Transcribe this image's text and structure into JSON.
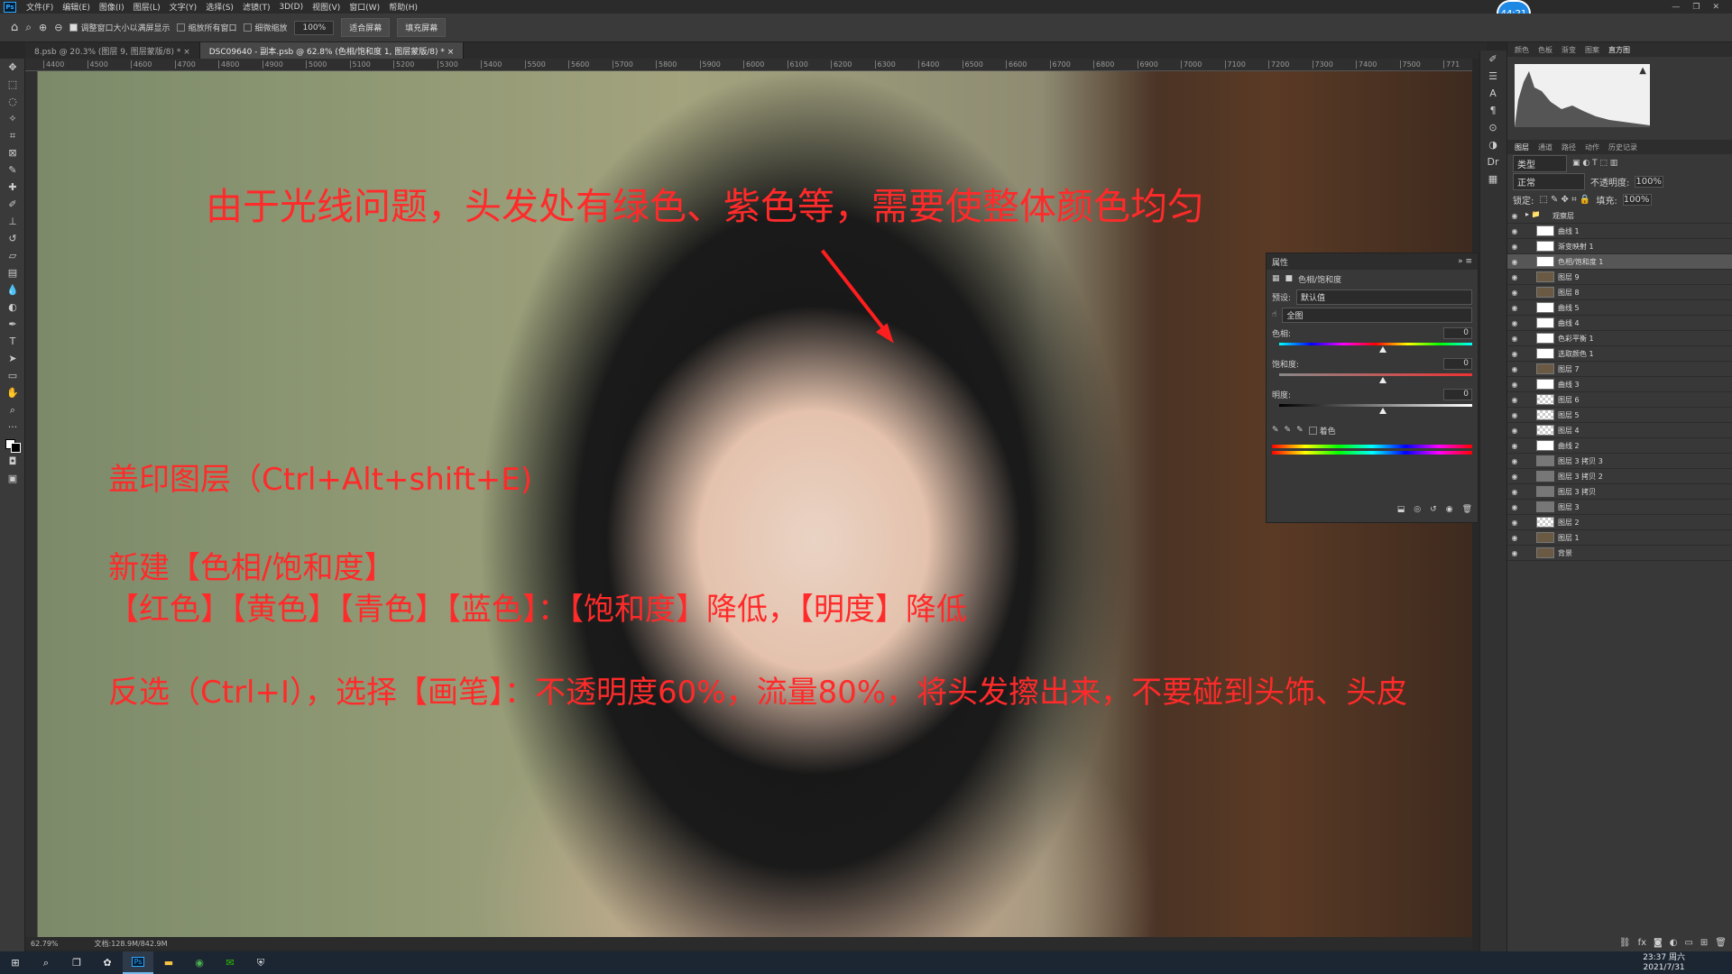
{
  "menubar": {
    "items": [
      "文件(F)",
      "编辑(E)",
      "图像(I)",
      "图层(L)",
      "文字(Y)",
      "选择(S)",
      "滤镜(T)",
      "3D(D)",
      "视图(V)",
      "窗口(W)",
      "帮助(H)"
    ]
  },
  "options": {
    "resize_windows": "调整窗口大小以满屏显示",
    "zoom_all": "缩放所有窗口",
    "scrubby_zoom": "细微缩放",
    "zoom_value": "100%",
    "fit_screen": "适合屏幕",
    "fill_screen": "填充屏幕"
  },
  "doc_tabs": [
    {
      "label": "8.psb @ 20.3% (图层 9, 图层蒙版/8) *"
    },
    {
      "label": "DSC09640 - 副本.psb @ 62.8% (色相/饱和度 1, 图层蒙版/8) *"
    }
  ],
  "ruler_ticks": [
    "4400",
    "4500",
    "4600",
    "4700",
    "4800",
    "4900",
    "5000",
    "5100",
    "5200",
    "5300",
    "5400",
    "5500",
    "5600",
    "5700",
    "5800",
    "5900",
    "6000",
    "6100",
    "6200",
    "6300",
    "6400",
    "6500",
    "6600",
    "6700",
    "6800",
    "6900",
    "7000",
    "7100",
    "7200",
    "7300",
    "7400",
    "7500",
    "771"
  ],
  "annotations": {
    "headline": "由于光线问题，头发处有绿色、紫色等，需要使整体颜色均匀",
    "step1": "盖印图层（Ctrl+Alt+shift+E)",
    "step2": "新建【色相/饱和度】",
    "step3": "【红色】【黄色】【青色】【蓝色】：【饱和度】降低，【明度】降低",
    "step4": "反选（Ctrl+I），选择【画笔】：不透明度60%，流量80%，将头发擦出来，不要碰到头饰、头皮"
  },
  "status": {
    "zoom": "62.79%",
    "doc_size": "文档:128.9M/842.9M"
  },
  "properties": {
    "title": "属性",
    "adj_name": "色相/饱和度",
    "preset_label": "预设:",
    "preset_value": "默认值",
    "range_value": "全图",
    "hue_label": "色相:",
    "hue_value": "0",
    "sat_label": "饱和度:",
    "sat_value": "0",
    "light_label": "明度:",
    "light_value": "0",
    "colorize_label": "着色"
  },
  "timer": "44:21",
  "right_panel": {
    "top_tabs": [
      "颜色",
      "色板",
      "渐变",
      "图案",
      "直方图"
    ],
    "layer_tabs": [
      "图层",
      "通道",
      "路径",
      "动作",
      "历史记录"
    ],
    "kind_filter": "类型",
    "blend_mode": "正常",
    "opacity_label": "不透明度:",
    "opacity": "100%",
    "lock_label": "锁定:",
    "fill_label": "填充:",
    "fill": "100%",
    "layers": [
      {
        "name": "观察层",
        "type": "group"
      },
      {
        "name": "曲线 1",
        "type": "adj"
      },
      {
        "name": "渐变映射 1",
        "type": "adj"
      },
      {
        "name": "色相/饱和度 1",
        "type": "adj",
        "selected": true
      },
      {
        "name": "图层 9",
        "type": "photo"
      },
      {
        "name": "图层 8",
        "type": "photo"
      },
      {
        "name": "曲线 5",
        "type": "adj"
      },
      {
        "name": "曲线 4",
        "type": "adj"
      },
      {
        "name": "色彩平衡 1",
        "type": "adj"
      },
      {
        "name": "选取颜色 1",
        "type": "adj"
      },
      {
        "name": "图层 7",
        "type": "photo"
      },
      {
        "name": "曲线 3",
        "type": "adj"
      },
      {
        "name": "图层 6",
        "type": "checker"
      },
      {
        "name": "图层 5",
        "type": "checker"
      },
      {
        "name": "图层 4",
        "type": "checker"
      },
      {
        "name": "曲线 2",
        "type": "adj"
      },
      {
        "name": "图层 3 拷贝 3",
        "type": "gray"
      },
      {
        "name": "图层 3 拷贝 2",
        "type": "gray"
      },
      {
        "name": "图层 3 拷贝",
        "type": "gray"
      },
      {
        "name": "图层 3",
        "type": "gray"
      },
      {
        "name": "图层 2",
        "type": "checker"
      },
      {
        "name": "图层 1",
        "type": "photo"
      },
      {
        "name": "背景",
        "type": "photo"
      }
    ]
  },
  "taskbar": {
    "time": "23:37 周六",
    "date": "2021/7/31"
  },
  "colors": {
    "annotation_red": "#ff2a2a",
    "panel_bg": "#383838",
    "accent_blue": "#1e88e5"
  }
}
